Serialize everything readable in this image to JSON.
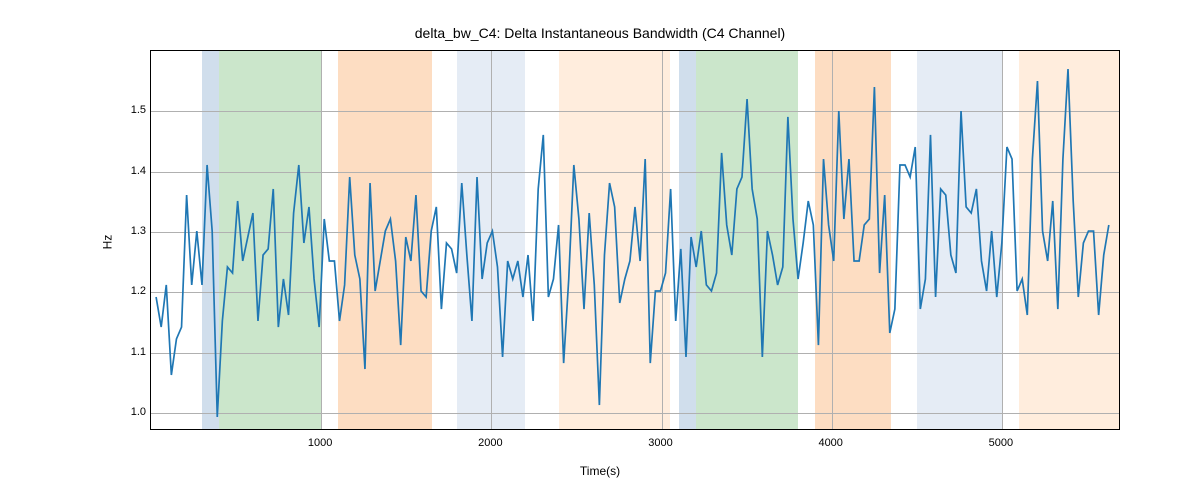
{
  "chart_data": {
    "type": "line",
    "title": "delta_bw_C4: Delta Instantaneous Bandwidth (C4 Channel)",
    "xlabel": "Time(s)",
    "ylabel": "Hz",
    "xlim": [
      0,
      5700
    ],
    "ylim": [
      0.97,
      1.6
    ],
    "x_ticks": [
      1000,
      2000,
      3000,
      4000,
      5000
    ],
    "y_ticks": [
      1.0,
      1.1,
      1.2,
      1.3,
      1.4,
      1.5
    ],
    "bands": [
      {
        "start": 300,
        "end": 400,
        "color": "blue"
      },
      {
        "start": 400,
        "end": 1000,
        "color": "green"
      },
      {
        "start": 1100,
        "end": 1650,
        "color": "orange"
      },
      {
        "start": 1800,
        "end": 2200,
        "color": "lightblue"
      },
      {
        "start": 2400,
        "end": 3050,
        "color": "lightorange"
      },
      {
        "start": 3100,
        "end": 3200,
        "color": "blue"
      },
      {
        "start": 3200,
        "end": 3800,
        "color": "green"
      },
      {
        "start": 3900,
        "end": 4350,
        "color": "orange"
      },
      {
        "start": 4500,
        "end": 5000,
        "color": "lightblue"
      },
      {
        "start": 5100,
        "end": 5700,
        "color": "lightorange"
      }
    ],
    "x": [
      30,
      60,
      90,
      120,
      150,
      180,
      210,
      240,
      270,
      300,
      330,
      360,
      390,
      420,
      450,
      480,
      510,
      540,
      570,
      600,
      630,
      660,
      690,
      720,
      750,
      780,
      810,
      840,
      870,
      900,
      930,
      960,
      990,
      1020,
      1050,
      1080,
      1110,
      1140,
      1170,
      1200,
      1230,
      1260,
      1290,
      1320,
      1350,
      1380,
      1410,
      1440,
      1470,
      1500,
      1530,
      1560,
      1590,
      1620,
      1650,
      1680,
      1710,
      1740,
      1770,
      1800,
      1830,
      1860,
      1890,
      1920,
      1950,
      1980,
      2010,
      2040,
      2070,
      2100,
      2130,
      2160,
      2190,
      2220,
      2250,
      2280,
      2310,
      2340,
      2370,
      2400,
      2430,
      2460,
      2490,
      2520,
      2550,
      2580,
      2610,
      2640,
      2670,
      2700,
      2730,
      2760,
      2790,
      2820,
      2850,
      2880,
      2910,
      2940,
      2970,
      3000,
      3030,
      3060,
      3090,
      3120,
      3150,
      3180,
      3210,
      3240,
      3270,
      3300,
      3330,
      3360,
      3390,
      3420,
      3450,
      3480,
      3510,
      3540,
      3570,
      3600,
      3630,
      3660,
      3690,
      3720,
      3750,
      3780,
      3810,
      3840,
      3870,
      3900,
      3930,
      3960,
      3990,
      4020,
      4050,
      4080,
      4110,
      4140,
      4170,
      4200,
      4230,
      4260,
      4290,
      4320,
      4350,
      4380,
      4410,
      4440,
      4470,
      4500,
      4530,
      4560,
      4590,
      4620,
      4650,
      4680,
      4710,
      4740,
      4770,
      4800,
      4830,
      4860,
      4890,
      4920,
      4950,
      4980,
      5010,
      5040,
      5070,
      5100,
      5130,
      5160,
      5190,
      5220,
      5250,
      5280,
      5310,
      5340,
      5370,
      5400,
      5430,
      5460,
      5490,
      5520,
      5550,
      5580,
      5610,
      5640
    ],
    "values": [
      1.19,
      1.14,
      1.21,
      1.06,
      1.12,
      1.14,
      1.36,
      1.21,
      1.3,
      1.21,
      1.41,
      1.3,
      0.99,
      1.15,
      1.24,
      1.23,
      1.35,
      1.25,
      1.29,
      1.33,
      1.15,
      1.26,
      1.27,
      1.37,
      1.14,
      1.22,
      1.16,
      1.33,
      1.41,
      1.28,
      1.34,
      1.22,
      1.14,
      1.32,
      1.25,
      1.25,
      1.15,
      1.21,
      1.39,
      1.26,
      1.22,
      1.07,
      1.38,
      1.2,
      1.25,
      1.3,
      1.32,
      1.25,
      1.11,
      1.29,
      1.25,
      1.36,
      1.2,
      1.19,
      1.3,
      1.34,
      1.17,
      1.28,
      1.27,
      1.23,
      1.38,
      1.26,
      1.15,
      1.39,
      1.22,
      1.28,
      1.3,
      1.24,
      1.09,
      1.25,
      1.22,
      1.25,
      1.19,
      1.26,
      1.15,
      1.37,
      1.46,
      1.19,
      1.22,
      1.31,
      1.08,
      1.22,
      1.41,
      1.32,
      1.17,
      1.33,
      1.21,
      1.01,
      1.26,
      1.38,
      1.34,
      1.18,
      1.22,
      1.25,
      1.34,
      1.25,
      1.42,
      1.08,
      1.2,
      1.2,
      1.23,
      1.37,
      1.15,
      1.27,
      1.09,
      1.29,
      1.24,
      1.3,
      1.21,
      1.2,
      1.23,
      1.43,
      1.31,
      1.26,
      1.37,
      1.39,
      1.52,
      1.37,
      1.32,
      1.09,
      1.3,
      1.26,
      1.21,
      1.24,
      1.49,
      1.32,
      1.22,
      1.28,
      1.35,
      1.31,
      1.11,
      1.42,
      1.31,
      1.25,
      1.5,
      1.32,
      1.42,
      1.25,
      1.25,
      1.31,
      1.32,
      1.54,
      1.23,
      1.36,
      1.13,
      1.17,
      1.41,
      1.41,
      1.39,
      1.44,
      1.17,
      1.22,
      1.46,
      1.19,
      1.37,
      1.36,
      1.26,
      1.23,
      1.5,
      1.34,
      1.33,
      1.37,
      1.25,
      1.2,
      1.3,
      1.19,
      1.28,
      1.44,
      1.42,
      1.2,
      1.22,
      1.16,
      1.42,
      1.55,
      1.3,
      1.25,
      1.35,
      1.17,
      1.42,
      1.57,
      1.35,
      1.19,
      1.28,
      1.3,
      1.3,
      1.16,
      1.26,
      1.31
    ]
  }
}
